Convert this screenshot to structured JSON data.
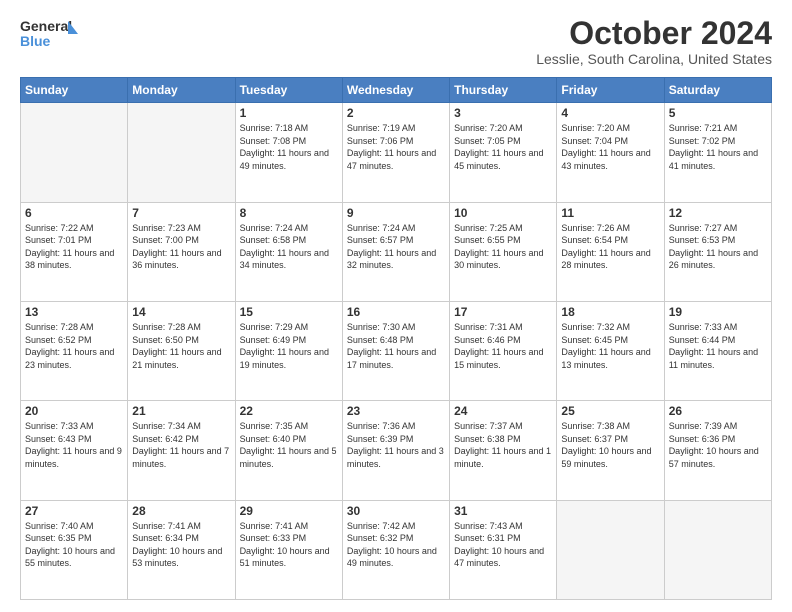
{
  "logo": {
    "line1": "General",
    "line2": "Blue"
  },
  "title": "October 2024",
  "subtitle": "Lesslie, South Carolina, United States",
  "weekdays": [
    "Sunday",
    "Monday",
    "Tuesday",
    "Wednesday",
    "Thursday",
    "Friday",
    "Saturday"
  ],
  "weeks": [
    [
      {
        "day": "",
        "info": ""
      },
      {
        "day": "",
        "info": ""
      },
      {
        "day": "1",
        "info": "Sunrise: 7:18 AM\nSunset: 7:08 PM\nDaylight: 11 hours and 49 minutes."
      },
      {
        "day": "2",
        "info": "Sunrise: 7:19 AM\nSunset: 7:06 PM\nDaylight: 11 hours and 47 minutes."
      },
      {
        "day": "3",
        "info": "Sunrise: 7:20 AM\nSunset: 7:05 PM\nDaylight: 11 hours and 45 minutes."
      },
      {
        "day": "4",
        "info": "Sunrise: 7:20 AM\nSunset: 7:04 PM\nDaylight: 11 hours and 43 minutes."
      },
      {
        "day": "5",
        "info": "Sunrise: 7:21 AM\nSunset: 7:02 PM\nDaylight: 11 hours and 41 minutes."
      }
    ],
    [
      {
        "day": "6",
        "info": "Sunrise: 7:22 AM\nSunset: 7:01 PM\nDaylight: 11 hours and 38 minutes."
      },
      {
        "day": "7",
        "info": "Sunrise: 7:23 AM\nSunset: 7:00 PM\nDaylight: 11 hours and 36 minutes."
      },
      {
        "day": "8",
        "info": "Sunrise: 7:24 AM\nSunset: 6:58 PM\nDaylight: 11 hours and 34 minutes."
      },
      {
        "day": "9",
        "info": "Sunrise: 7:24 AM\nSunset: 6:57 PM\nDaylight: 11 hours and 32 minutes."
      },
      {
        "day": "10",
        "info": "Sunrise: 7:25 AM\nSunset: 6:55 PM\nDaylight: 11 hours and 30 minutes."
      },
      {
        "day": "11",
        "info": "Sunrise: 7:26 AM\nSunset: 6:54 PM\nDaylight: 11 hours and 28 minutes."
      },
      {
        "day": "12",
        "info": "Sunrise: 7:27 AM\nSunset: 6:53 PM\nDaylight: 11 hours and 26 minutes."
      }
    ],
    [
      {
        "day": "13",
        "info": "Sunrise: 7:28 AM\nSunset: 6:52 PM\nDaylight: 11 hours and 23 minutes."
      },
      {
        "day": "14",
        "info": "Sunrise: 7:28 AM\nSunset: 6:50 PM\nDaylight: 11 hours and 21 minutes."
      },
      {
        "day": "15",
        "info": "Sunrise: 7:29 AM\nSunset: 6:49 PM\nDaylight: 11 hours and 19 minutes."
      },
      {
        "day": "16",
        "info": "Sunrise: 7:30 AM\nSunset: 6:48 PM\nDaylight: 11 hours and 17 minutes."
      },
      {
        "day": "17",
        "info": "Sunrise: 7:31 AM\nSunset: 6:46 PM\nDaylight: 11 hours and 15 minutes."
      },
      {
        "day": "18",
        "info": "Sunrise: 7:32 AM\nSunset: 6:45 PM\nDaylight: 11 hours and 13 minutes."
      },
      {
        "day": "19",
        "info": "Sunrise: 7:33 AM\nSunset: 6:44 PM\nDaylight: 11 hours and 11 minutes."
      }
    ],
    [
      {
        "day": "20",
        "info": "Sunrise: 7:33 AM\nSunset: 6:43 PM\nDaylight: 11 hours and 9 minutes."
      },
      {
        "day": "21",
        "info": "Sunrise: 7:34 AM\nSunset: 6:42 PM\nDaylight: 11 hours and 7 minutes."
      },
      {
        "day": "22",
        "info": "Sunrise: 7:35 AM\nSunset: 6:40 PM\nDaylight: 11 hours and 5 minutes."
      },
      {
        "day": "23",
        "info": "Sunrise: 7:36 AM\nSunset: 6:39 PM\nDaylight: 11 hours and 3 minutes."
      },
      {
        "day": "24",
        "info": "Sunrise: 7:37 AM\nSunset: 6:38 PM\nDaylight: 11 hours and 1 minute."
      },
      {
        "day": "25",
        "info": "Sunrise: 7:38 AM\nSunset: 6:37 PM\nDaylight: 10 hours and 59 minutes."
      },
      {
        "day": "26",
        "info": "Sunrise: 7:39 AM\nSunset: 6:36 PM\nDaylight: 10 hours and 57 minutes."
      }
    ],
    [
      {
        "day": "27",
        "info": "Sunrise: 7:40 AM\nSunset: 6:35 PM\nDaylight: 10 hours and 55 minutes."
      },
      {
        "day": "28",
        "info": "Sunrise: 7:41 AM\nSunset: 6:34 PM\nDaylight: 10 hours and 53 minutes."
      },
      {
        "day": "29",
        "info": "Sunrise: 7:41 AM\nSunset: 6:33 PM\nDaylight: 10 hours and 51 minutes."
      },
      {
        "day": "30",
        "info": "Sunrise: 7:42 AM\nSunset: 6:32 PM\nDaylight: 10 hours and 49 minutes."
      },
      {
        "day": "31",
        "info": "Sunrise: 7:43 AM\nSunset: 6:31 PM\nDaylight: 10 hours and 47 minutes."
      },
      {
        "day": "",
        "info": ""
      },
      {
        "day": "",
        "info": ""
      }
    ]
  ]
}
